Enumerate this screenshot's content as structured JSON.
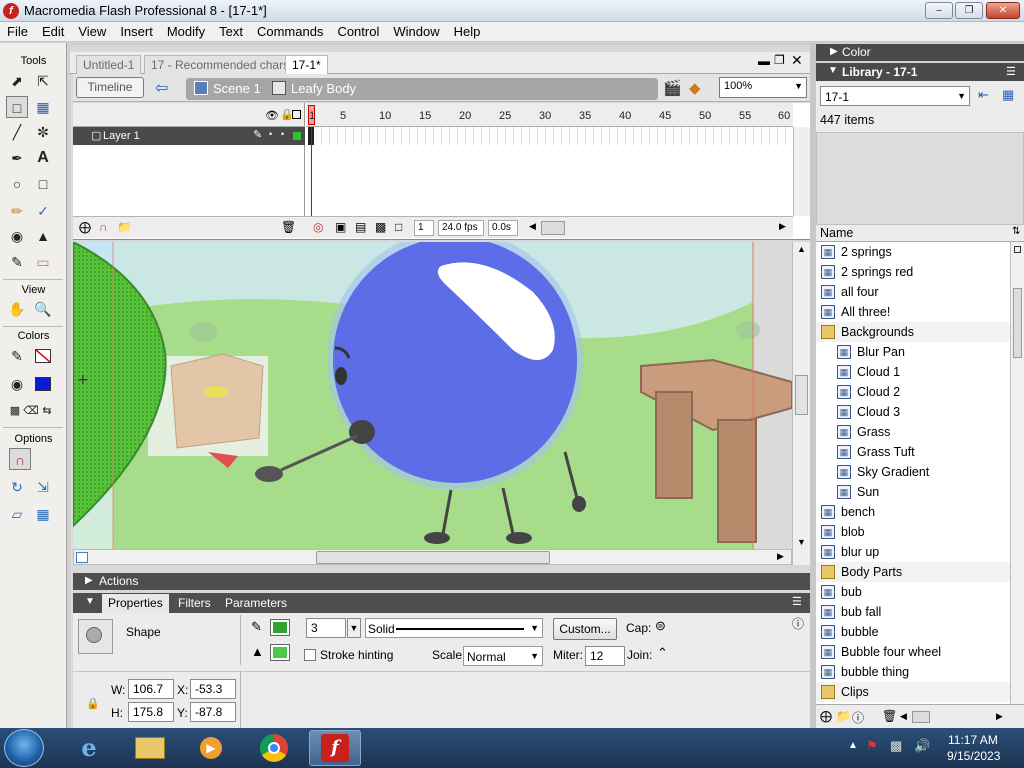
{
  "window": {
    "title": "Macromedia Flash Professional 8 - [17-1*]",
    "icon_glyph": "f"
  },
  "menu": [
    "File",
    "Edit",
    "View",
    "Insert",
    "Modify",
    "Text",
    "Commands",
    "Control",
    "Window",
    "Help"
  ],
  "tools": {
    "label": "Tools",
    "view_label": "View",
    "colors_label": "Colors",
    "options_label": "Options"
  },
  "doc_tabs": [
    {
      "label": "Untitled-1"
    },
    {
      "label": "17 - Recommended chars"
    },
    {
      "label": "17-1*"
    }
  ],
  "edit_bar": {
    "timeline_button": "Timeline",
    "scene": "Scene 1",
    "symbol": "Leafy Body",
    "zoom": "100%"
  },
  "timeline": {
    "layer_name": "Layer 1",
    "frame_numbers": [
      "1",
      "5",
      "10",
      "15",
      "20",
      "25",
      "30",
      "35",
      "40",
      "45",
      "50",
      "55",
      "60"
    ],
    "current_frame": "1",
    "fps": "24.0 fps",
    "time": "0.0s"
  },
  "panels": {
    "actions_label": "Actions",
    "properties_tab": "Properties",
    "filters_tab": "Filters",
    "parameters_tab": "Parameters"
  },
  "properties": {
    "type": "Shape",
    "stroke_height": "3",
    "stroke_style": "Solid",
    "custom_button": "Custom...",
    "cap_label": "Cap:",
    "join_label": "Join:",
    "stroke_hinting": "Stroke hinting",
    "scale_label": "Scale:",
    "scale_value": "Normal",
    "miter_label": "Miter:",
    "miter_value": "12",
    "w_label": "W:",
    "w_value": "106.7",
    "h_label": "H:",
    "h_value": "175.8",
    "x_label": "X:",
    "x_value": "-53.3",
    "y_label": "Y:",
    "y_value": "-87.8",
    "stroke_color": "#2fa52f",
    "fill_color": "#4fc84f"
  },
  "right_panels": {
    "color_title": "Color",
    "library_title": "Library - 17-1"
  },
  "library": {
    "doc_select": "17-1",
    "item_count": "447 items",
    "column_name": "Name",
    "items": [
      {
        "name": "2 springs",
        "kind": "symbol",
        "child": false
      },
      {
        "name": "2 springs red",
        "kind": "symbol",
        "child": false
      },
      {
        "name": "all four",
        "kind": "symbol",
        "child": false
      },
      {
        "name": "All three!",
        "kind": "symbol",
        "child": false
      },
      {
        "name": "Backgrounds",
        "kind": "folder-open",
        "child": false
      },
      {
        "name": "Blur Pan",
        "kind": "symbol",
        "child": true
      },
      {
        "name": "Cloud 1",
        "kind": "symbol",
        "child": true
      },
      {
        "name": "Cloud 2",
        "kind": "symbol",
        "child": true
      },
      {
        "name": "Cloud 3",
        "kind": "symbol",
        "child": true
      },
      {
        "name": "Grass",
        "kind": "symbol",
        "child": true
      },
      {
        "name": "Grass Tuft",
        "kind": "symbol",
        "child": true
      },
      {
        "name": "Sky Gradient",
        "kind": "symbol",
        "child": true
      },
      {
        "name": "Sun",
        "kind": "symbol",
        "child": true
      },
      {
        "name": "bench",
        "kind": "symbol",
        "child": false
      },
      {
        "name": "blob",
        "kind": "symbol",
        "child": false
      },
      {
        "name": "blur up",
        "kind": "symbol",
        "child": false
      },
      {
        "name": "Body Parts",
        "kind": "folder",
        "child": false
      },
      {
        "name": "bub",
        "kind": "symbol",
        "child": false
      },
      {
        "name": "bub fall",
        "kind": "symbol",
        "child": false
      },
      {
        "name": "bubble",
        "kind": "symbol",
        "child": false
      },
      {
        "name": "Bubble four wheel",
        "kind": "symbol",
        "child": false
      },
      {
        "name": "bubble thing",
        "kind": "symbol",
        "child": false
      },
      {
        "name": "Clips",
        "kind": "folder",
        "child": false
      }
    ]
  },
  "taskbar": {
    "clock_time": "11:17 AM",
    "clock_date": "9/15/2023",
    "apps": [
      "internet-explorer",
      "file-explorer",
      "media-player",
      "chrome",
      "flash"
    ]
  }
}
